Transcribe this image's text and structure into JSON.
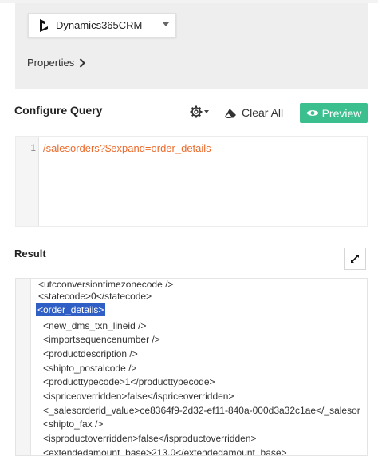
{
  "connector": {
    "label": "Dynamics365CRM"
  },
  "properties": {
    "label": "Properties"
  },
  "configure": {
    "title": "Configure Query",
    "clear_label": "Clear All",
    "preview_label": "Preview"
  },
  "editor": {
    "line_number": "1",
    "query": "/salesorders?$expand=order_details"
  },
  "result": {
    "title": "Result",
    "lines": [
      "<utcconversiontimezonecode />",
      "<statecode>0</statecode>",
      "<order_details>",
      "<new_dms_txn_lineid />",
      "<importsequencenumber />",
      "<productdescription />",
      "<shipto_postalcode />",
      "<producttypecode>1</producttypecode>",
      "<ispriceoverridden>false</ispriceoverridden>",
      "<_salesorderid_value>ce8364f9-2d32-ef11-840a-000d3a32c1ae</_salesor",
      "<shipto_fax />",
      "<isproductoverridden>false</isproductoverridden>",
      "<extendedamount_base>213.0</extendedamount_base>"
    ]
  },
  "colors": {
    "preview_button": "#3bbf8f",
    "query_text": "#ec6a2b",
    "selection": "#2f5ec4"
  }
}
